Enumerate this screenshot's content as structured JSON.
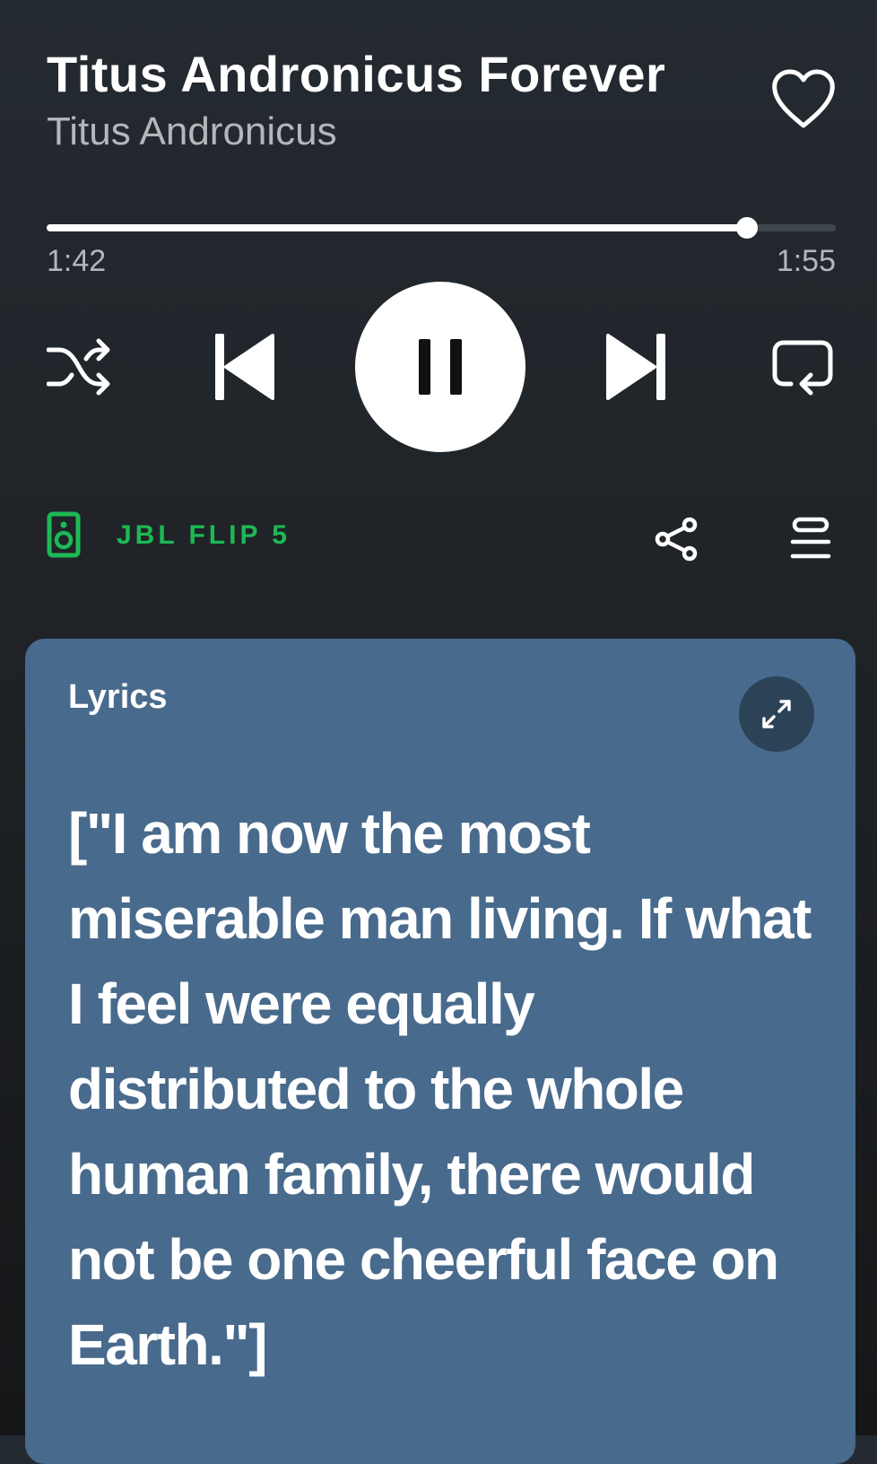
{
  "track": {
    "title": "Titus Andronicus Forever",
    "artist": "Titus Andronicus",
    "liked": false
  },
  "playback": {
    "elapsed": "1:42",
    "duration": "1:55",
    "progress_fraction": 0.887,
    "state": "playing"
  },
  "controls": {
    "shuffle_icon": "shuffle-icon",
    "previous_icon": "skip-previous-icon",
    "play_pause_icon": "pause-icon",
    "next_icon": "skip-next-icon",
    "repeat_icon": "repeat-icon"
  },
  "device": {
    "icon": "speaker-icon",
    "name": "JBL FLIP 5"
  },
  "actions": {
    "share_icon": "share-icon",
    "queue_icon": "queue-icon"
  },
  "lyrics": {
    "heading": "Lyrics",
    "expand_icon": "expand-icon",
    "text": "[\"I am now the most miserable man living. If what I feel were equally distributed to the whole human family, there would not be one cheerful face on Earth.\"]"
  },
  "colors": {
    "background": "#242a31",
    "accent": "#1db954",
    "lyrics_card": "#486a8c",
    "expand_button": "#2c4257"
  }
}
